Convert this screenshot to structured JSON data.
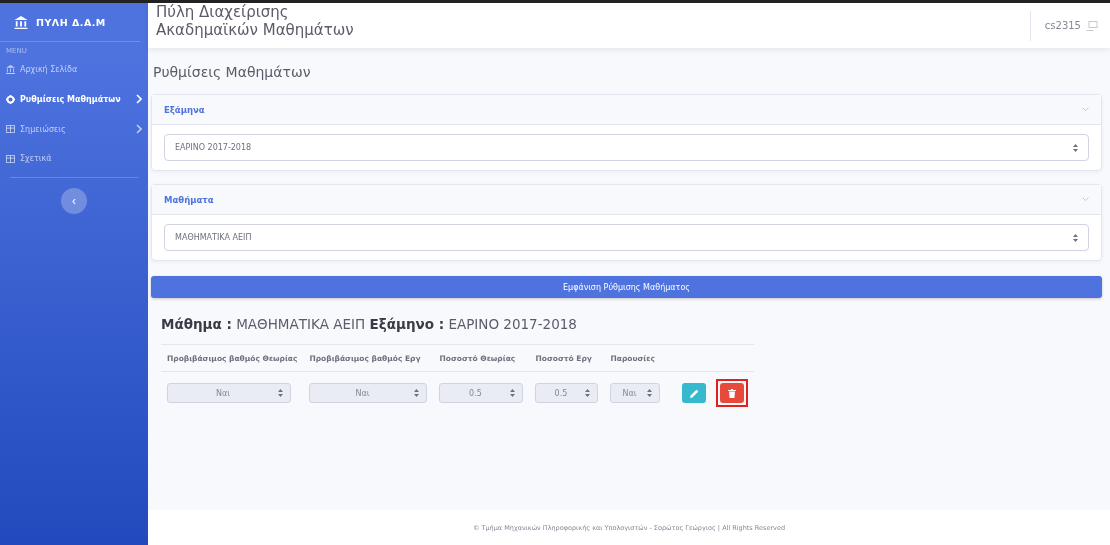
{
  "sidebar": {
    "brand": "ΠΥΛΗ Δ.Α.Μ",
    "section_label": "MENU",
    "items": [
      {
        "label": "Αρχική Σελίδα",
        "kind": "home",
        "selected": false,
        "has_submenu": false
      },
      {
        "label": "Ρυθμίσεις Μαθημάτων",
        "kind": "settings",
        "selected": true,
        "has_submenu": true
      },
      {
        "label": "Σημειώσεις",
        "kind": "grid",
        "selected": false,
        "has_submenu": true
      },
      {
        "label": "Σχετικά",
        "kind": "grid",
        "selected": false,
        "has_submenu": false
      }
    ],
    "toggle": "‹"
  },
  "topbar": {
    "title_lines": [
      "Πύλη Διαχείρισης",
      "Ακαδημαϊκών Μαθημάτων"
    ],
    "user": "cs2315"
  },
  "page_title": "Ρυθμίσεις Μαθημάτων",
  "cards": [
    {
      "title": "Εξάμηνα",
      "value": "ΕΑΡΙΝΟ 2017-2018"
    },
    {
      "title": "Μαθήματα",
      "value": "ΜΑΘΗΜΑΤΙΚΑ ΑΕΙΠ"
    }
  ],
  "show_button": "Εμφάνιση Ρύθμισης Μαθήματος",
  "summary": "**Μάθημα :** ΜΑΘΗΜΑΤΙΚΑ ΑΕΙΠ **Εξάμηνο :** ΕΑΡΙΝΟ 2017-2018",
  "table": {
    "columns": [
      "Προβιβάσιμος βαθμός Θεωρίας",
      "Προβιβάσιμος βαθμός Εργ",
      "Ποσοστό Θεωρίας",
      "Ποσοστό Εργ",
      "Παρουσίες"
    ],
    "rows": [
      {
        "values": [
          "Ναι",
          "Ναι",
          "0.5",
          "0.5",
          "Ναι"
        ],
        "actions": [
          {
            "kind": "edit",
            "highlighted": false
          },
          {
            "kind": "delete",
            "highlighted": true
          }
        ]
      }
    ]
  },
  "footer": "© Τμήμα Μηχανικών Πληροφορικής και Υπολογιστών - Σορώτος Γεώργιος | All Rights Reserved"
}
